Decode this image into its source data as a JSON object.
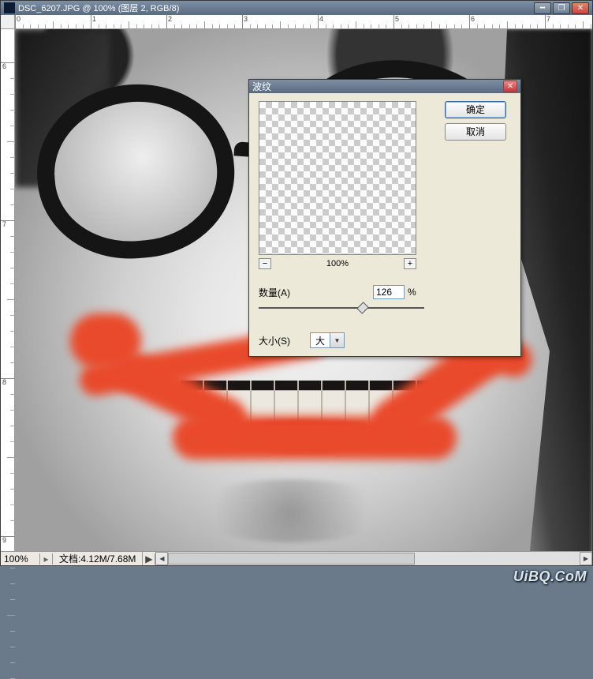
{
  "window": {
    "title": "DSC_6207.JPG @ 100% (图层 2, RGB/8)"
  },
  "ruler_top": [
    "0",
    "1",
    "2",
    "3",
    "4",
    "5",
    "6",
    "7"
  ],
  "ruler_left": [
    "6",
    "7",
    "8",
    "9"
  ],
  "statusbar": {
    "zoom": "100%",
    "doc_label": "文档:",
    "doc_value": "4.12M/7.68M"
  },
  "dialog": {
    "title": "波纹",
    "ok_label": "确定",
    "cancel_label": "取消",
    "zoom_label": "100%",
    "amount_label": "数量(A)",
    "amount_value": "126",
    "amount_unit": "%",
    "amount_min": 0,
    "amount_max": 200,
    "size_label": "大小(S)",
    "size_value": "大"
  },
  "logo": "UiBQ.CoM"
}
